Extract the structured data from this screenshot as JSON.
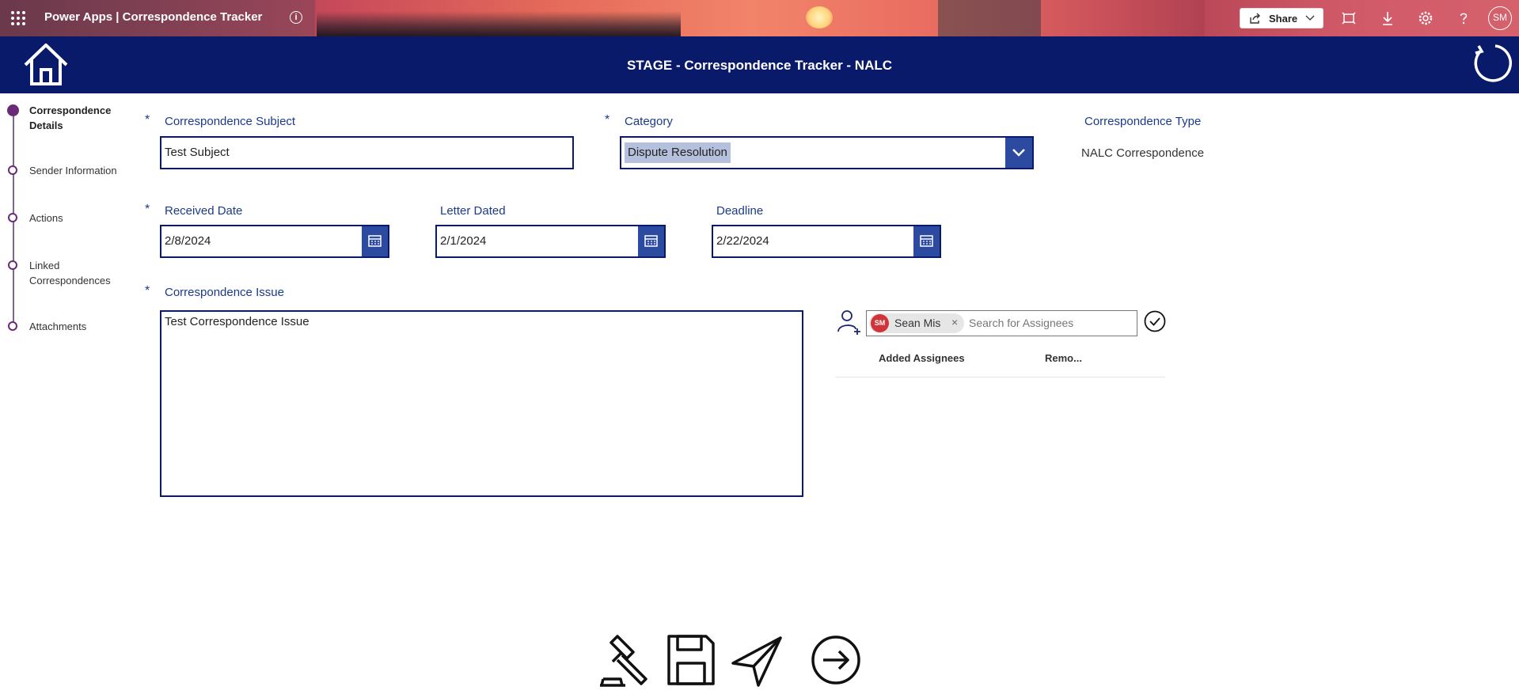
{
  "appbar": {
    "title": "Power Apps  |  Correspondence Tracker",
    "share_label": "Share",
    "avatar_initials": "SM"
  },
  "header": {
    "title": "STAGE - Correspondence Tracker  - NALC"
  },
  "steps": [
    {
      "label": "Correspondence Details",
      "active": true
    },
    {
      "label": "Sender Information",
      "active": false
    },
    {
      "label": "Actions",
      "active": false
    },
    {
      "label": "Linked Correspondences",
      "active": false
    },
    {
      "label": "Attachments",
      "active": false
    }
  ],
  "form": {
    "required_mark": "*",
    "subject": {
      "label": "Correspondence Subject",
      "value": "Test Subject"
    },
    "category": {
      "label": "Category",
      "value": "Dispute Resolution"
    },
    "type": {
      "label": "Correspondence Type",
      "value": "NALC Correspondence"
    },
    "received_date": {
      "label": "Received Date",
      "value": "2/8/2024"
    },
    "letter_dated": {
      "label": "Letter Dated",
      "value": "2/1/2024"
    },
    "deadline": {
      "label": "Deadline",
      "value": "2/22/2024"
    },
    "issue": {
      "label": "Correspondence Issue",
      "value": "Test Correspondence Issue"
    }
  },
  "assignees": {
    "chip_initials": "SM",
    "chip_name": "Sean Mis",
    "chip_remove": "×",
    "search_placeholder": "Search for Assignees",
    "columns": [
      "Added Assignees",
      "Remo..."
    ]
  },
  "colors": {
    "header": "#0a1a6b",
    "accent_button": "#2c4aa0",
    "step_accent": "#6b2a78",
    "label_blue": "#1a3a8a"
  }
}
